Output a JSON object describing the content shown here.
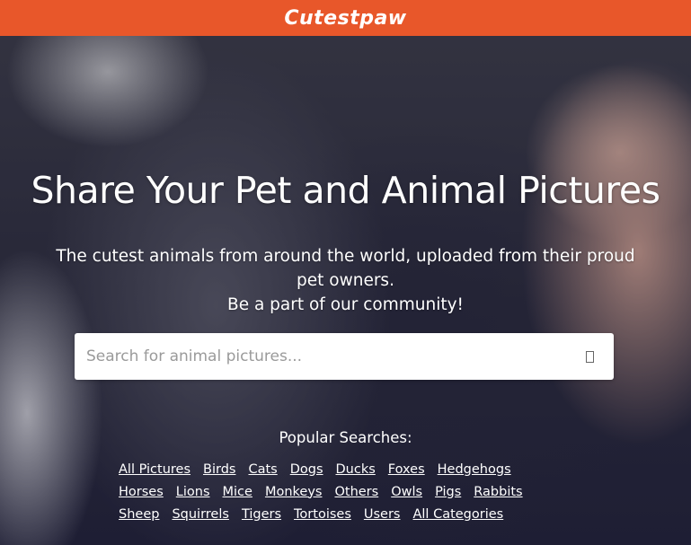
{
  "header": {
    "logo": "Cutestpaw",
    "color": "#e8572a"
  },
  "hero": {
    "headline": "Share Your Pet and Animal Pictures",
    "subline_1": "The cutest animals from around the world, uploaded from their proud pet owners.",
    "subline_2": "Be a part of our community!"
  },
  "search": {
    "placeholder": "Search for animal pictures...",
    "value": "",
    "button_icon": "search-icon"
  },
  "popular": {
    "title": "Popular Searches:",
    "rows": [
      [
        "All Pictures",
        "Birds",
        "Cats",
        "Dogs",
        "Ducks",
        "Foxes",
        "Hedgehogs"
      ],
      [
        "Horses",
        "Lions",
        "Mice",
        "Monkeys",
        "Others",
        "Owls",
        "Pigs",
        "Rabbits"
      ],
      [
        "Sheep",
        "Squirrels",
        "Tigers",
        "Tortoises",
        "Users",
        "All Categories"
      ]
    ]
  }
}
